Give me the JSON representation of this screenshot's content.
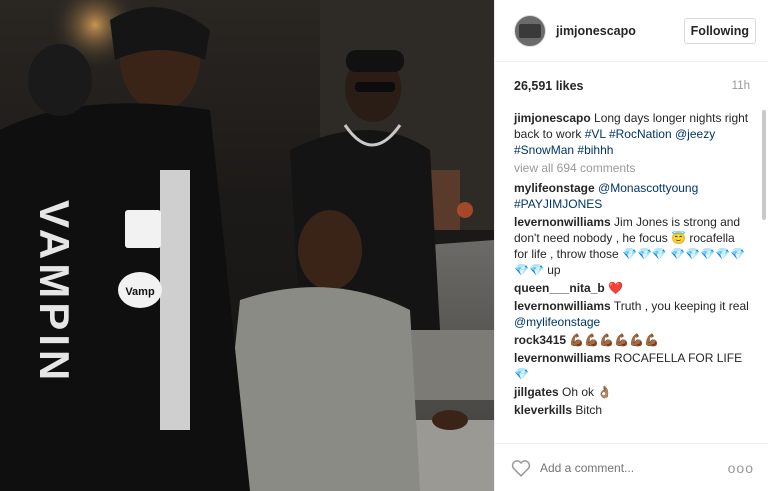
{
  "post": {
    "username": "jimjonescapo",
    "follow_label": "Following",
    "likes": "26,591 likes",
    "time": "11h"
  },
  "photo": {
    "jacket_text": "VAMPIN",
    "patch_text": "Vamp"
  },
  "comments": [
    {
      "user": "jimjonescapo",
      "segments": [
        {
          "t": "Long days longer nights right back to work ",
          "tag": false
        },
        {
          "t": "#VL",
          "tag": true
        },
        {
          "t": " ",
          "tag": false
        },
        {
          "t": "#RocNation",
          "tag": true
        },
        {
          "t": " ",
          "tag": false
        },
        {
          "t": "@jeezy",
          "tag": true
        },
        {
          "t": " ",
          "tag": false
        },
        {
          "t": "#SnowMan",
          "tag": true
        },
        {
          "t": " ",
          "tag": false
        },
        {
          "t": "#bihhh",
          "tag": true
        }
      ]
    },
    {
      "view_all": "view all 694 comments"
    },
    {
      "user": "mylifeonstage",
      "segments": [
        {
          "t": "@Monascottyoung",
          "tag": true
        },
        {
          "t": " ",
          "tag": false
        },
        {
          "t": "#PAYJIMJONES",
          "tag": true
        }
      ]
    },
    {
      "user": "levernonwilliams",
      "segments": [
        {
          "t": "Jim Jones is strong and don't need nobody , he focus 😇 rocafella for life , throw those 💎💎💎 💎💎💎💎💎💎💎 up",
          "tag": false
        }
      ]
    },
    {
      "user": "queen___nita_b",
      "segments": [
        {
          "t": "❤️",
          "tag": false
        }
      ]
    },
    {
      "user": "levernonwilliams",
      "segments": [
        {
          "t": "Truth , you keeping it real ",
          "tag": false
        },
        {
          "t": "@mylifeonstage",
          "tag": true
        }
      ]
    },
    {
      "user": "rock3415",
      "segments": [
        {
          "t": "💪🏾💪🏾💪🏾💪🏾💪🏾💪🏾",
          "tag": false
        }
      ]
    },
    {
      "user": "levernonwilliams",
      "segments": [
        {
          "t": "ROCAFELLA FOR LIFE 💎",
          "tag": false
        }
      ]
    },
    {
      "user": "jillgates",
      "segments": [
        {
          "t": "Oh ok 👌🏽",
          "tag": false
        }
      ]
    },
    {
      "user": "kleverkills",
      "segments": [
        {
          "t": "Bitch",
          "tag": false
        }
      ]
    }
  ],
  "footer": {
    "placeholder": "Add a comment...",
    "more": "ooo"
  },
  "colors": {
    "hashtag": "#003569",
    "muted": "#999999",
    "border": "#efefef"
  }
}
